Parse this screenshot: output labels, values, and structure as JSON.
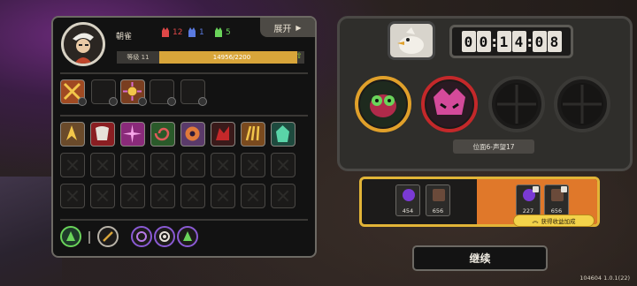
{
  "player": {
    "name": "朝雀",
    "level_label": "等级 11",
    "xp_text": "14956/2200",
    "xp_fraction": 0.95
  },
  "stats": [
    {
      "icon": "red-demon-icon",
      "value": "12",
      "color": "#e04848"
    },
    {
      "icon": "blue-demon-icon",
      "value": "1",
      "color": "#5a7ae0"
    },
    {
      "icon": "green-demon-icon",
      "value": "5",
      "color": "#6ad45a"
    }
  ],
  "expand_label": "展开",
  "timer": {
    "h": "00",
    "m": "14",
    "s": "08"
  },
  "location_label": "位面6-声望17",
  "rewards": {
    "left": [
      {
        "icon": "purple-orb-icon",
        "value": "454"
      },
      {
        "icon": "stone-tile-icon",
        "value": "656"
      }
    ],
    "right": [
      {
        "icon": "purple-orb-icon",
        "value": "227"
      },
      {
        "icon": "stone-tile-icon",
        "value": "656"
      }
    ],
    "bonus_label": "获得收益加成"
  },
  "continue_label": "继续",
  "version": "104604 1.0.1(22)",
  "colors": {
    "accent": "#e2b437",
    "orange": "#e0782a",
    "xp": "#d8a53a"
  }
}
